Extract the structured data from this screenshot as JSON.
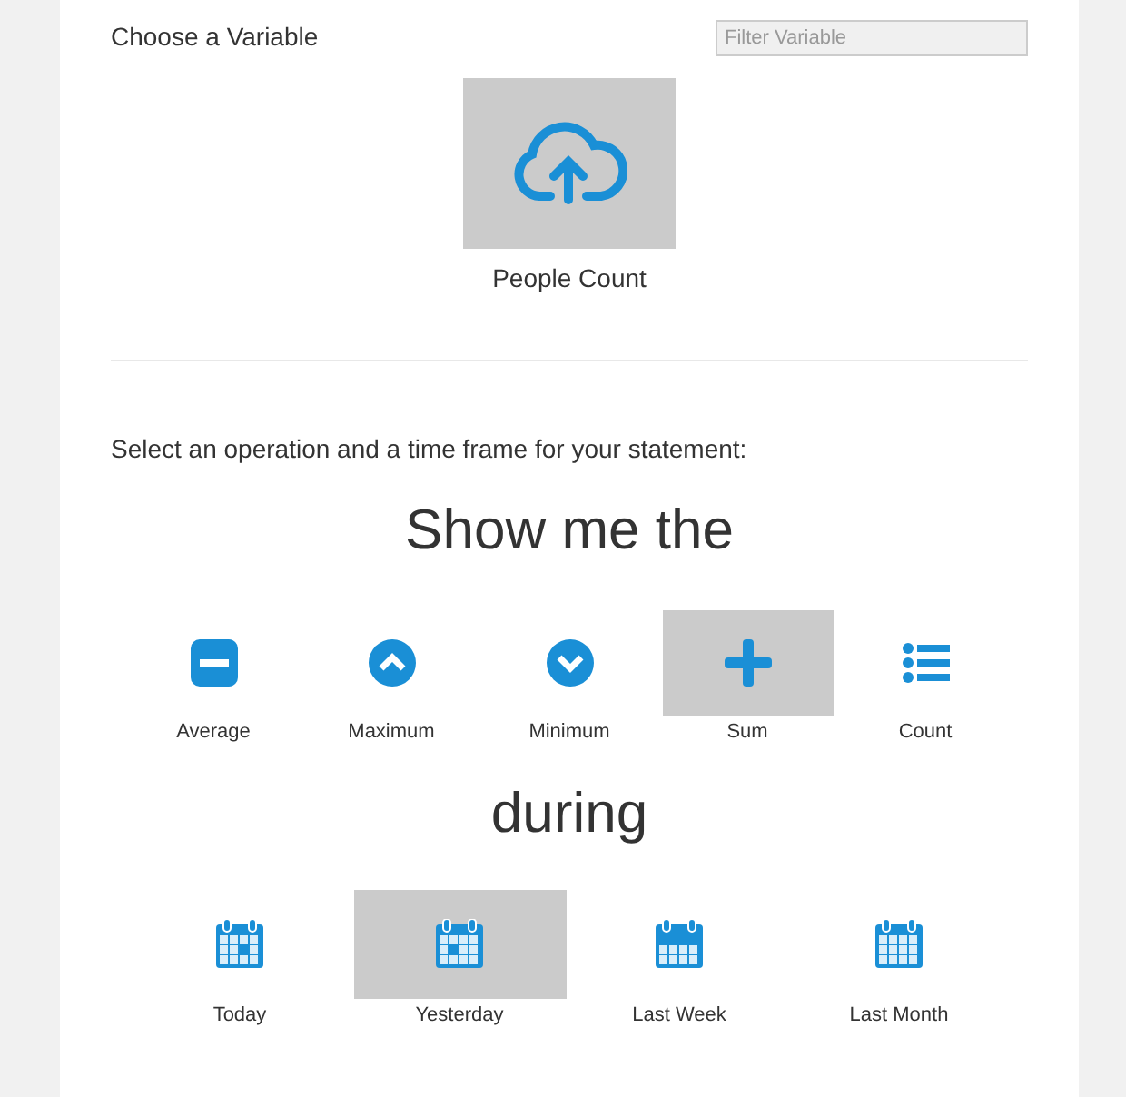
{
  "variable_section": {
    "title": "Choose a Variable",
    "filter": {
      "placeholder": "Filter Variable"
    },
    "variables": [
      {
        "label": "People Count",
        "selected": true
      }
    ]
  },
  "operation_section": {
    "prompt": "Select an operation and a time frame for your statement:",
    "heading": "Show me the",
    "operations": [
      {
        "kind": "average",
        "label": "Average",
        "selected": false
      },
      {
        "kind": "maximum",
        "label": "Maximum",
        "selected": false
      },
      {
        "kind": "minimum",
        "label": "Minimum",
        "selected": false
      },
      {
        "kind": "sum",
        "label": "Sum",
        "selected": true
      },
      {
        "kind": "count",
        "label": "Count",
        "selected": false
      }
    ],
    "connector": "during",
    "time_frames": [
      {
        "kind": "today",
        "label": "Today",
        "selected": false
      },
      {
        "kind": "yesterday",
        "label": "Yesterday",
        "selected": true
      },
      {
        "kind": "week",
        "label": "Last Week",
        "selected": false
      },
      {
        "kind": "month",
        "label": "Last Month",
        "selected": false
      }
    ]
  }
}
